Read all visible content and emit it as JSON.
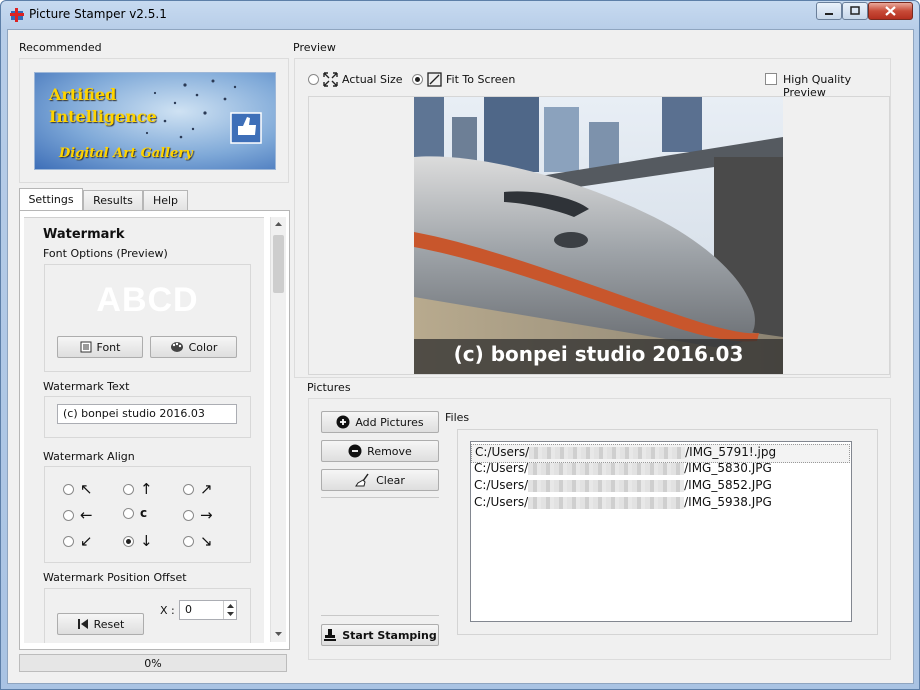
{
  "window": {
    "title": "Picture Stamper v2.5.1"
  },
  "recommended": {
    "label": "Recommended",
    "banner_line1": "Artified",
    "banner_line2": "Intelligence",
    "banner_line3": "Digital Art Gallery"
  },
  "tabs": [
    "Settings",
    "Results",
    "Help"
  ],
  "settings": {
    "watermark_heading": "Watermark",
    "font_options_label": "Font Options (Preview)",
    "font_preview": "ABCD",
    "font_button": "Font",
    "color_button": "Color",
    "watermark_text_label": "Watermark Text",
    "watermark_text_value": "(c) bonpei studio 2016.03",
    "align_label": "Watermark Align",
    "align_options": [
      "↖",
      "↑",
      "↗",
      "←",
      "c",
      "→",
      "↙",
      "↓",
      "↘"
    ],
    "align_selected": "↓",
    "offset_label": "Watermark Position Offset",
    "reset_button": "Reset",
    "x_label": "X :",
    "x_value": "0"
  },
  "progress": {
    "text": "0%",
    "value": 0
  },
  "preview": {
    "label": "Preview",
    "actual_size": "Actual Size",
    "fit_to_screen": "Fit To Screen",
    "fit_selected": true,
    "high_quality": "High Quality Preview",
    "high_quality_checked": false,
    "watermark_overlay": "(c) bonpei studio 2016.03"
  },
  "pictures": {
    "label": "Pictures",
    "add_button": "Add Pictures",
    "remove_button": "Remove",
    "clear_button": "Clear",
    "start_button": "Start Stamping",
    "files_label": "Files",
    "files": [
      {
        "prefix": "C:/Users/",
        "suffix": "/IMG_5791!.jpg"
      },
      {
        "prefix": "C:/Users/",
        "suffix": "/IMG_5830.JPG"
      },
      {
        "prefix": "C:/Users/",
        "suffix": "/IMG_5852.JPG"
      },
      {
        "prefix": "C:/Users/",
        "suffix": "/IMG_5938.JPG"
      }
    ]
  },
  "colors": {
    "accent_blue": "#3e6fb8",
    "banner_text": "#ffd400",
    "titlebar": "#b7cde8"
  }
}
